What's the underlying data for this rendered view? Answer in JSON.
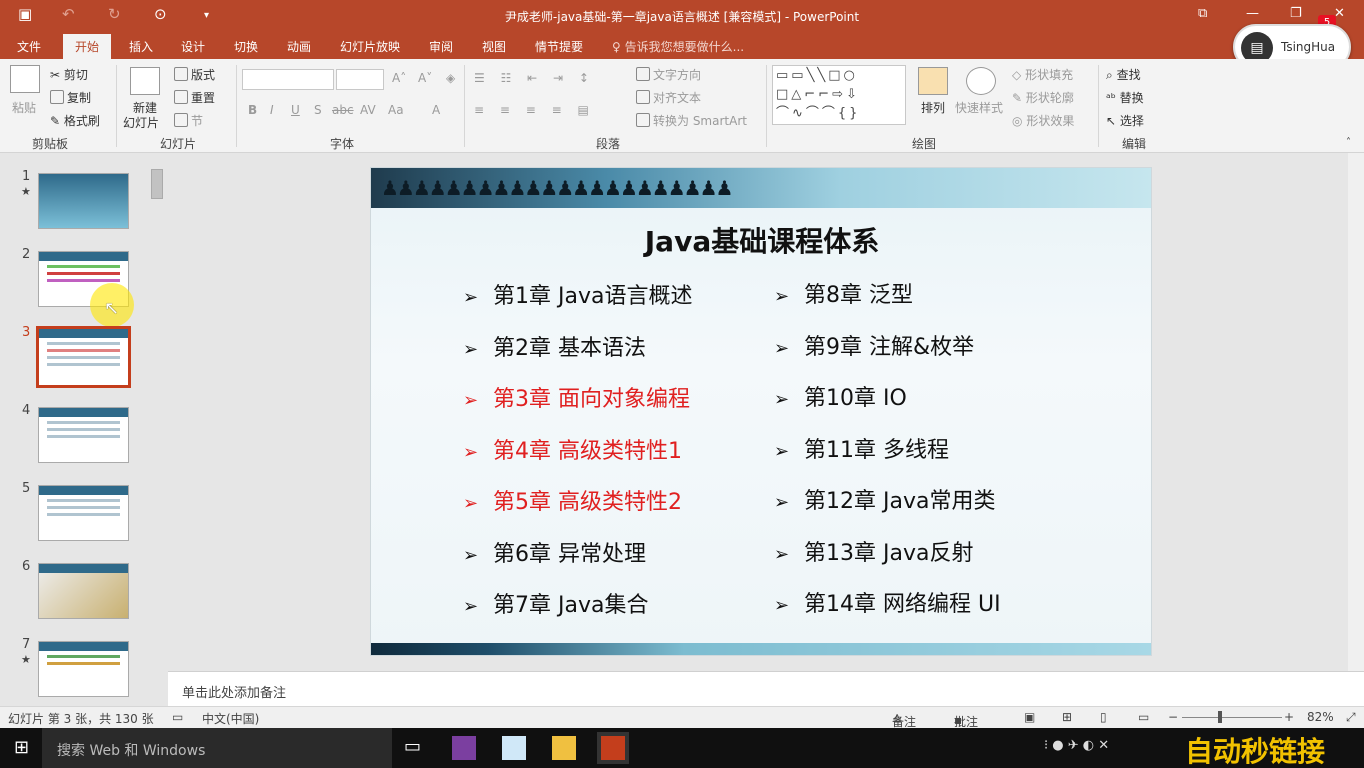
{
  "window": {
    "title": "尹成老师-java基础-第一章java语言概述 [兼容模式] - PowerPoint",
    "badge": "5"
  },
  "tabs": [
    "文件",
    "开始",
    "插入",
    "设计",
    "切换",
    "动画",
    "幻灯片放映",
    "审阅",
    "视图",
    "情节提要"
  ],
  "tell_me": "告诉我您想要做什么...",
  "user": {
    "name": "TsingHua"
  },
  "ribbon": {
    "clipboard": {
      "paste": "粘贴",
      "cut": "剪切",
      "copy": "复制",
      "format_painter": "格式刷",
      "label": "剪贴板"
    },
    "slides": {
      "new_slide_1": "新建",
      "new_slide_2": "幻灯片",
      "layout": "版式",
      "reset": "重置",
      "section": "节",
      "label": "幻灯片"
    },
    "font": {
      "label": "字体",
      "bold": "B",
      "italic": "I",
      "underline": "U",
      "shadow": "S",
      "strike": "abc",
      "spacing": "AV",
      "case": "Aa",
      "color": "A"
    },
    "paragraph": {
      "text_direction": "文字方向",
      "align_text": "对齐文本",
      "smartart": "转换为 SmartArt",
      "label": "段落"
    },
    "drawing": {
      "arrange": "排列",
      "quick_styles": "快速样式",
      "shape_fill": "形状填充",
      "shape_outline": "形状轮廓",
      "shape_effects": "形状效果",
      "label": "绘图"
    },
    "editing": {
      "find": "查找",
      "replace": "替换",
      "select": "选择",
      "label": "编辑"
    }
  },
  "thumbnails": [
    "1",
    "2",
    "3",
    "4",
    "5",
    "6",
    "7"
  ],
  "selected_slide": 3,
  "slide": {
    "title": "Java基础课程体系",
    "left_items": [
      {
        "text": "第1章 Java语言概述",
        "red": false
      },
      {
        "text": "第2章 基本语法",
        "red": false
      },
      {
        "text": "第3章 面向对象编程",
        "red": true
      },
      {
        "text": "第4章 高级类特性1",
        "red": true
      },
      {
        "text": "第5章 高级类特性2",
        "red": true
      },
      {
        "text": "第6章 异常处理",
        "red": false
      },
      {
        "text": "第7章 Java集合",
        "red": false
      }
    ],
    "right_items": [
      {
        "text": "第8章 泛型"
      },
      {
        "text": "第9章 注解&枚举"
      },
      {
        "text": "第10章 IO"
      },
      {
        "text": "第11章 多线程"
      },
      {
        "text": "第12章 Java常用类"
      },
      {
        "text": "第13章 Java反射"
      },
      {
        "text": "第14章 网络编程 UI"
      }
    ]
  },
  "notes_placeholder": "单击此处添加备注",
  "status": {
    "slide_info": "幻灯片 第 3 张，共 130 张",
    "language": "中文(中国)",
    "notes": "备注",
    "comments": "批注",
    "zoom": "82%"
  },
  "taskbar": {
    "search": "搜索 Web 和 Windows",
    "watermark": "自动秒链接"
  }
}
